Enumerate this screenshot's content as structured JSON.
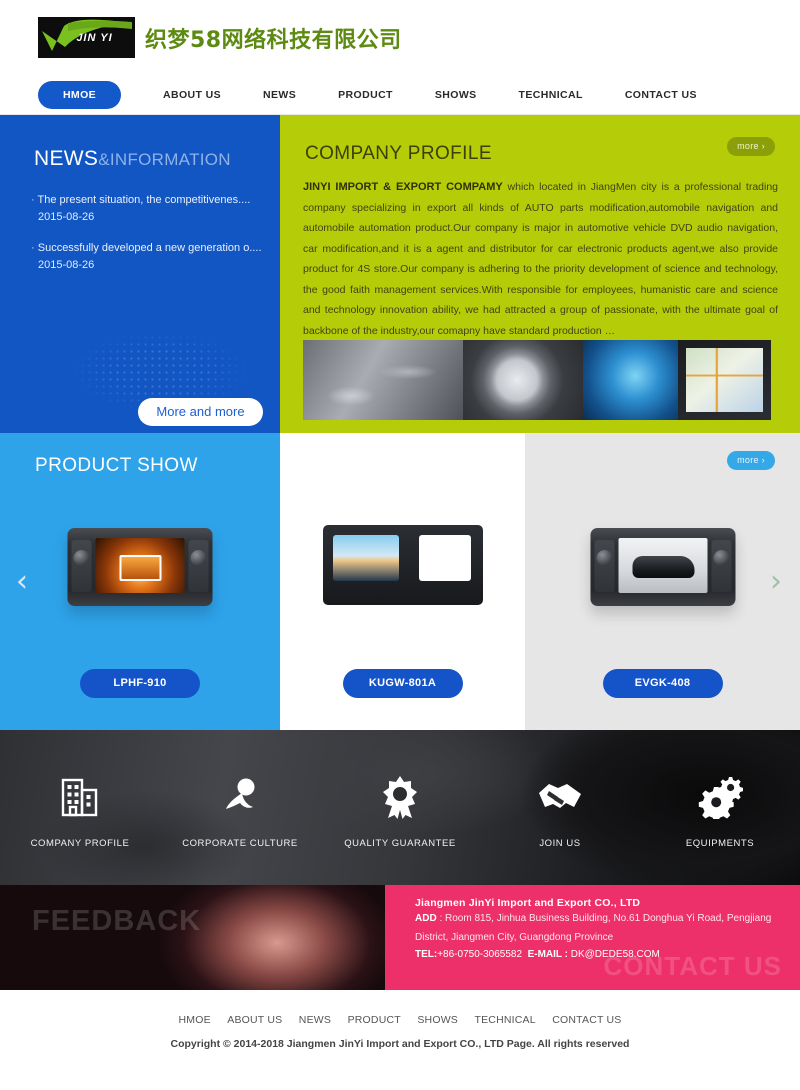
{
  "header": {
    "logo_mark_text": "JIN YI",
    "logo_company_cn": "织梦58网络科技有限公司"
  },
  "nav": {
    "items": [
      {
        "label": "HMOE",
        "active": true
      },
      {
        "label": "ABOUT US",
        "active": false
      },
      {
        "label": "NEWS",
        "active": false
      },
      {
        "label": "PRODUCT",
        "active": false
      },
      {
        "label": "SHOWS",
        "active": false
      },
      {
        "label": "TECHNICAL",
        "active": false
      },
      {
        "label": "CONTACT US",
        "active": false
      }
    ]
  },
  "news": {
    "title_main": "NEWS",
    "title_sub": "&INFORMATION",
    "items": [
      {
        "title": "The present situation, the competitivenes....",
        "date": "2015-08-26"
      },
      {
        "title": "Successfully developed a new generation o....",
        "date": "2015-08-26"
      }
    ],
    "more_label": "More and more"
  },
  "profile": {
    "title": "COMPANY PROFILE",
    "more_label": "more ›",
    "lead": "JINYI IMPORT & EXPORT COMPAMY",
    "body": " which located in JiangMen city is a professional trading company specializing in export all kinds of AUTO parts modification,automobile navigation and automobile automation product.Our company is major in automotive vehicle DVD audio navigation, car modification,and it is a agent and distributor for car electronic products agent,we also provide product for 4S store.Our company is adhering to the priority development of science and technology, the good faith management services.With responsible for employees, humanistic care and science and technology innovation ability, we had attracted a group of passionate, with the ultimate goal of backbone of the industry,our comapny have standard production …"
  },
  "products": {
    "title": "PRODUCT SHOW",
    "more_label": "more ›",
    "prev_arrow": "‹",
    "next_arrow": "›",
    "items": [
      {
        "name": "LPHF-910"
      },
      {
        "name": "KUGW-801A"
      },
      {
        "name": "EVGK-408"
      }
    ]
  },
  "features": {
    "items": [
      {
        "label": "COMPANY PROFILE",
        "icon": "building-icon"
      },
      {
        "label": "CORPORATE CULTURE",
        "icon": "microphone-icon"
      },
      {
        "label": "QUALITY GUARANTEE",
        "icon": "award-ribbon-icon"
      },
      {
        "label": "JOIN US",
        "icon": "handshake-icon"
      },
      {
        "label": "EQUIPMENTS",
        "icon": "gears-icon"
      }
    ]
  },
  "feedback": {
    "overlay_text": "FEEDBACK"
  },
  "contact": {
    "watermark": "CONTACT US",
    "company": "Jiangmen JinYi Import and Export CO., LTD",
    "add_label": "ADD",
    "address": " : Room 815, Jinhua Business Building, No.61 Donghua Yi Road, Pengjiang District, Jiangmen City, Guangdong Province",
    "tel_label": "TEL:",
    "tel": "+86-0750-3065582",
    "email_label": "E-MAIL :",
    "email": "DK@DEDE58.COM"
  },
  "footer": {
    "nav": [
      "HMOE",
      "ABOUT US",
      "NEWS",
      "PRODUCT",
      "SHOWS",
      "TECHNICAL",
      "CONTACT US"
    ],
    "copyright": "Copyright © 2014-2018 Jiangmen JinYi Import and Export CO., LTD   Page. All rights reserved"
  },
  "colors": {
    "brand_blue": "#1256c4",
    "accent_green": "#b5cc09",
    "light_blue": "#2ea3ea",
    "pink": "#ed2f6a",
    "logo_green": "#5d8b12"
  }
}
